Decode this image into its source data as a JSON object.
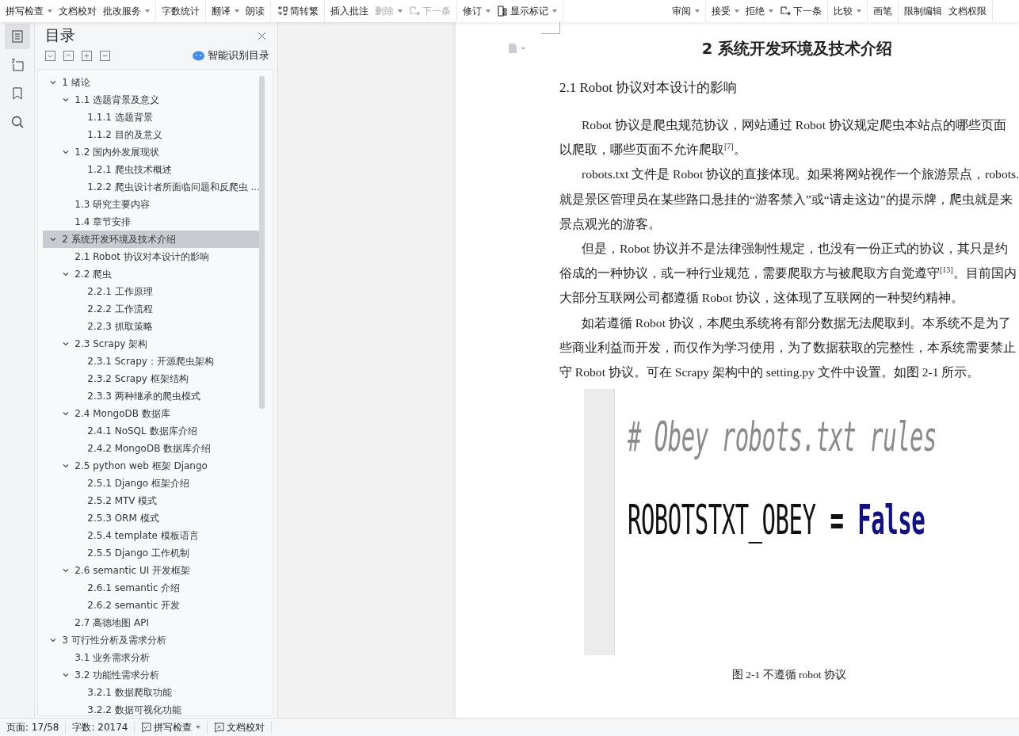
{
  "toolbar": {
    "groups": [
      [
        {
          "label": "拼写检查",
          "dropdown": true,
          "disabled": false
        },
        {
          "label": "文档校对",
          "dropdown": false,
          "disabled": false
        },
        {
          "label": "批改服务",
          "dropdown": true,
          "disabled": false
        }
      ],
      [
        {
          "label": "字数统计",
          "dropdown": false,
          "disabled": false
        }
      ],
      [
        {
          "label": "翻译",
          "dropdown": true,
          "disabled": false
        },
        {
          "label": "朗读",
          "dropdown": false,
          "disabled": false
        }
      ],
      [
        {
          "label": "简转繁",
          "dropdown": false,
          "disabled": false,
          "kind": "convert"
        }
      ],
      [
        {
          "label": "插入批注",
          "dropdown": false,
          "disabled": false
        },
        {
          "label": "删除",
          "dropdown": true,
          "disabled": true
        },
        {
          "label": "下一条",
          "dropdown": false,
          "disabled": true,
          "kind": "next"
        }
      ],
      [
        {
          "label": "修订",
          "dropdown": true,
          "disabled": false
        },
        {
          "label": "显示标记",
          "dropdown": true,
          "disabled": false,
          "kind": "marks"
        }
      ],
      [
        {
          "label": "审阅",
          "dropdown": true,
          "disabled": false
        }
      ],
      [
        {
          "label": "接受",
          "dropdown": true,
          "disabled": false
        },
        {
          "label": "拒绝",
          "dropdown": true,
          "disabled": false
        },
        {
          "label": "下一条",
          "dropdown": false,
          "disabled": false,
          "kind": "next"
        }
      ],
      [
        {
          "label": "比较",
          "dropdown": true,
          "disabled": false
        }
      ],
      [
        {
          "label": "画笔",
          "dropdown": false,
          "disabled": false
        }
      ],
      [
        {
          "label": "限制编辑",
          "dropdown": false,
          "disabled": false
        },
        {
          "label": "文档权限",
          "dropdown": false,
          "disabled": false
        }
      ]
    ]
  },
  "rail": [
    {
      "kind": "toc",
      "selected": true
    },
    {
      "kind": "nav",
      "selected": false
    },
    {
      "kind": "bookmark",
      "selected": false
    },
    {
      "kind": "search",
      "selected": false
    }
  ],
  "sidebar": {
    "title": "目录",
    "smart_button": "智能识别目录",
    "toc": [
      {
        "label": "1  绪论",
        "selected": false,
        "expanded": true,
        "children": [
          {
            "label": "1.1  选题背景及意义",
            "selected": false,
            "expanded": true,
            "children": [
              {
                "label": "1.1.1 选题背景",
                "selected": false
              },
              {
                "label": "1.1.2 目的及意义",
                "selected": false
              }
            ]
          },
          {
            "label": "1.2  国内外发展现状",
            "selected": false,
            "expanded": true,
            "children": [
              {
                "label": "1.2.1  爬虫技术概述",
                "selected": false
              },
              {
                "label": "1.2.2  爬虫设计者所面临问题和反爬虫 ...",
                "selected": false
              }
            ]
          },
          {
            "label": "1.3  研究主要内容",
            "selected": false
          },
          {
            "label": "1.4  章节安排",
            "selected": false
          }
        ]
      },
      {
        "label": "2  系统开发环境及技术介绍",
        "selected": true,
        "expanded": true,
        "children": [
          {
            "label": "2.1 Robot 协议对本设计的影响",
            "selected": false
          },
          {
            "label": "2.2  爬虫",
            "selected": false,
            "expanded": true,
            "children": [
              {
                "label": "2.2.1  工作原理",
                "selected": false
              },
              {
                "label": "2.2.2  工作流程",
                "selected": false
              },
              {
                "label": "2.2.3  抓取策略",
                "selected": false
              }
            ]
          },
          {
            "label": "2.3 Scrapy 架构",
            "selected": false,
            "expanded": true,
            "children": [
              {
                "label": "2.3.1 Scrapy：开源爬虫架构",
                "selected": false
              },
              {
                "label": "2.3.2 Scrapy 框架结构",
                "selected": false
              },
              {
                "label": "2.3.3  两种继承的爬虫模式",
                "selected": false
              }
            ]
          },
          {
            "label": "2.4 MongoDB 数据库",
            "selected": false,
            "expanded": true,
            "children": [
              {
                "label": "2.4.1 NoSQL 数据库介绍",
                "selected": false
              },
              {
                "label": "2.4.2 MongoDB 数据库介绍",
                "selected": false
              }
            ]
          },
          {
            "label": "2.5 python web 框架 Django",
            "selected": false,
            "expanded": true,
            "children": [
              {
                "label": "2.5.1 Django 框架介绍",
                "selected": false
              },
              {
                "label": "2.5.2 MTV 模式",
                "selected": false
              },
              {
                "label": "2.5.3 ORM 模式",
                "selected": false
              },
              {
                "label": "2.5.4 template 模板语言",
                "selected": false
              },
              {
                "label": "2.5.5 Django 工作机制",
                "selected": false
              }
            ]
          },
          {
            "label": "2.6 semantic UI 开发框架",
            "selected": false,
            "expanded": true,
            "children": [
              {
                "label": "2.6.1 semantic 介绍",
                "selected": false
              },
              {
                "label": "2.6.2 semantic 开发",
                "selected": false
              }
            ]
          },
          {
            "label": "2.7  高德地图 API",
            "selected": false
          }
        ]
      },
      {
        "label": "3  可行性分析及需求分析",
        "selected": false,
        "expanded": true,
        "children": [
          {
            "label": "3.1  业务需求分析",
            "selected": false
          },
          {
            "label": "3.2  功能性需求分析",
            "selected": false,
            "expanded": true,
            "children": [
              {
                "label": "3.2.1  数据爬取功能",
                "selected": false
              },
              {
                "label": "3.2.2  数据可视化功能",
                "selected": false
              }
            ]
          }
        ]
      }
    ]
  },
  "document": {
    "chapter_title": "2  系统开发环境及技术介绍",
    "section_title": "2.1 Robot 协议对本设计的影响",
    "lines": [
      {
        "text": "Robot 协议是爬虫规范协议，网站通过 Robot 协议规定爬虫本站点的哪些页面",
        "indent": true
      },
      {
        "text": "以爬取，哪些页面不允许爬取$^{[7]}$。",
        "indent": false
      },
      {
        "text": "robots.txt 文件是 Robot 协议的直接体现。如果将网站视作一个旅游景点，robots.",
        "indent": true
      },
      {
        "text": "就是景区管理员在某些路口悬挂的“游客禁入”或“请走这边”的提示牌，爬虫就是来",
        "indent": false
      },
      {
        "text": "景点观光的游客。",
        "indent": false
      },
      {
        "text": "但是，Robot 协议并不是法律强制性规定，也没有一份正式的协议，其只是约",
        "indent": true
      },
      {
        "text": "俗成的一种协议，或一种行业规范，需要爬取方与被爬取方自觉遵守$^{[13]}$。目前国内",
        "indent": false
      },
      {
        "text": "大部分互联网公司都遵循 Robot 协议，这体现了互联网的一种契约精神。",
        "indent": false
      },
      {
        "text": "如若遵循 Robot 协议，本爬虫系统将有部分数据无法爬取到。本系统不是为了",
        "indent": true
      },
      {
        "text": "些商业利益而开发，而仅作为学习使用，为了数据获取的完整性，本系统需要禁止",
        "indent": false
      },
      {
        "text": "守 Robot 协议。可在 Scrapy 架构中的 setting.py 文件中设置。如图 2-1 所示。",
        "indent": false
      }
    ],
    "figure": {
      "code_lines": [
        [
          {
            "text": "# Obey robots.txt rules",
            "kind": "comment"
          }
        ],
        [
          {
            "text": "ROBOTSTXT_OBEY",
            "kind": "name"
          },
          {
            "text": "=",
            "kind": "op"
          },
          {
            "text": "False",
            "kind": "keyword"
          }
        ]
      ],
      "caption": "图 2-1  不遵循 robot 协议"
    }
  },
  "status_bar": {
    "page": "页面: 17/58",
    "words": "字数: 20174",
    "spell": "拼写检查",
    "proof": "文档校对"
  }
}
